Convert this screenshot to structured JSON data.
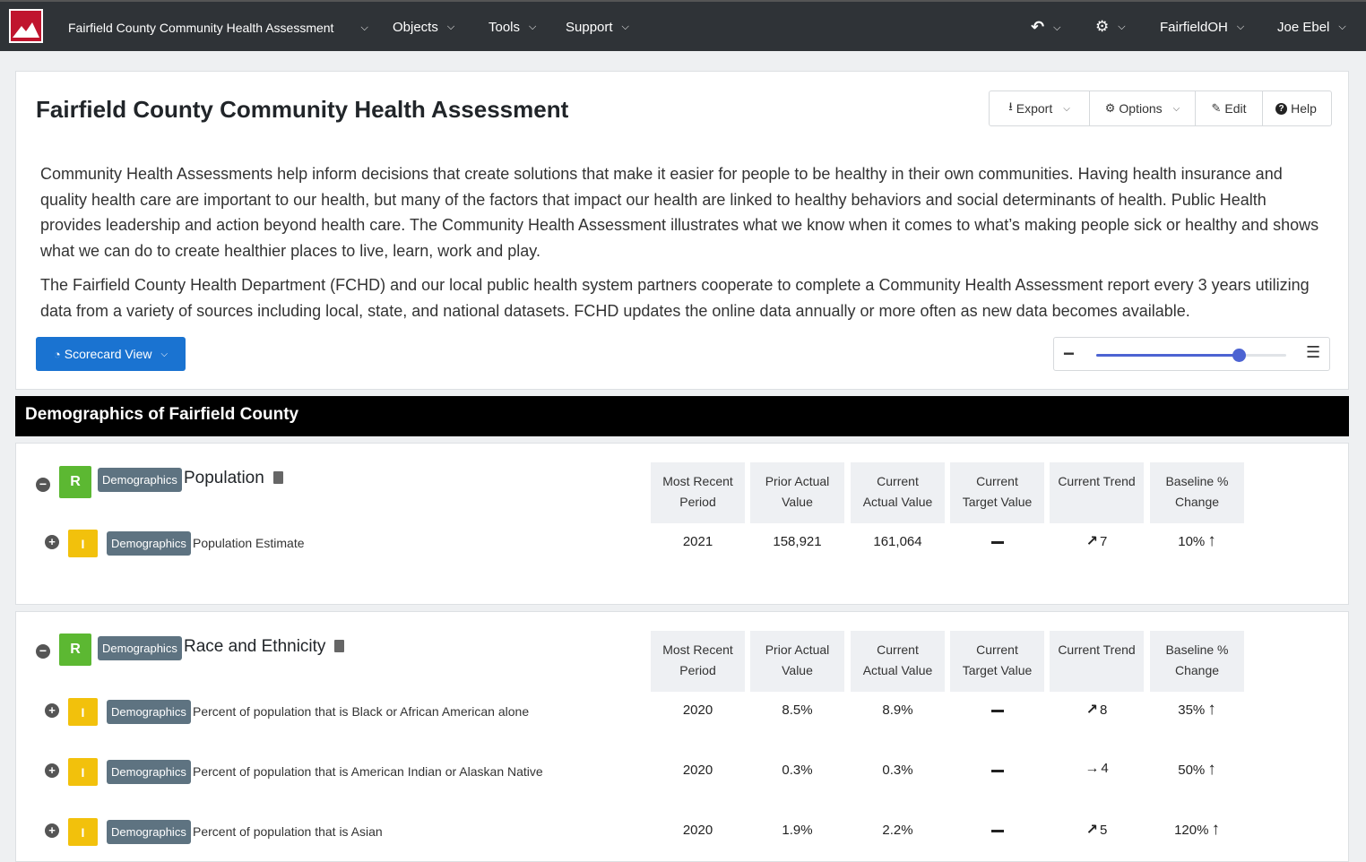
{
  "nav": {
    "app_title": "Fairfield County Community Health Assessment",
    "menus": [
      "Objects",
      "Tools",
      "Support"
    ],
    "org": "FairfieldOH",
    "user": "Joe Ebel"
  },
  "page": {
    "title": "Fairfield County Community Health Assessment",
    "buttons": {
      "export": "Export",
      "options": "Options",
      "edit": "Edit",
      "help": "Help"
    },
    "description": [
      "Community Health Assessments help inform decisions that create solutions that make it easier for people to be healthy in their own communities. Having health insurance and quality health care are important to our health, but many of the factors that impact our health are linked to healthy behaviors and social determinants of health. Public Health provides leadership and action beyond health care. The Community Health Assessment illustrates what we know when it comes to what’s making people sick or healthy and shows what we can do to create healthier places to live, learn, work and play.",
      "The Fairfield County Health Department (FCHD) and our local public health system partners cooperate to complete a Community Health Assessment report every 3 years utilizing data from a variety of sources including local, state, and national datasets. FCHD updates the online data annually or more often as new data becomes available."
    ],
    "view_button": "Scorecard View",
    "zoom_level": 0.75
  },
  "section": {
    "title": "Demographics of Fairfield County"
  },
  "columns": [
    [
      "Most Recent",
      "Period"
    ],
    [
      "Prior Actual",
      "Value"
    ],
    [
      "Current",
      "Actual Value"
    ],
    [
      "Current",
      "Target Value"
    ],
    [
      "Current Trend",
      ""
    ],
    [
      "Baseline %",
      "Change"
    ]
  ],
  "groups": [
    {
      "badge": "R",
      "tag": "Demographics",
      "title": "Population",
      "rows": [
        {
          "badge": "I",
          "tag": "Demographics",
          "label": "Population Estimate",
          "period": "2021",
          "prior": "158,921",
          "current": "161,064",
          "target": "",
          "trend_arrow": "↗",
          "trend": "7",
          "baseline": "10%",
          "baseline_arrow": "↑"
        }
      ]
    },
    {
      "badge": "R",
      "tag": "Demographics",
      "title": "Race and Ethnicity",
      "rows": [
        {
          "badge": "I",
          "tag": "Demographics",
          "label": "Percent of population that is Black or African American alone",
          "period": "2020",
          "prior": "8.5%",
          "current": "8.9%",
          "target": "",
          "trend_arrow": "↗",
          "trend": "8",
          "baseline": "35%",
          "baseline_arrow": "↑"
        },
        {
          "badge": "I",
          "tag": "Demographics",
          "label": "Percent of population that is American Indian or Alaskan Native",
          "period": "2020",
          "prior": "0.3%",
          "current": "0.3%",
          "target": "",
          "trend_arrow": "→",
          "trend": "4",
          "baseline": "50%",
          "baseline_arrow": "↑"
        },
        {
          "badge": "I",
          "tag": "Demographics",
          "label": "Percent of population that is Asian",
          "period": "2020",
          "prior": "1.9%",
          "current": "2.2%",
          "target": "",
          "trend_arrow": "↗",
          "trend": "5",
          "baseline": "120%",
          "baseline_arrow": "↑"
        }
      ]
    }
  ]
}
